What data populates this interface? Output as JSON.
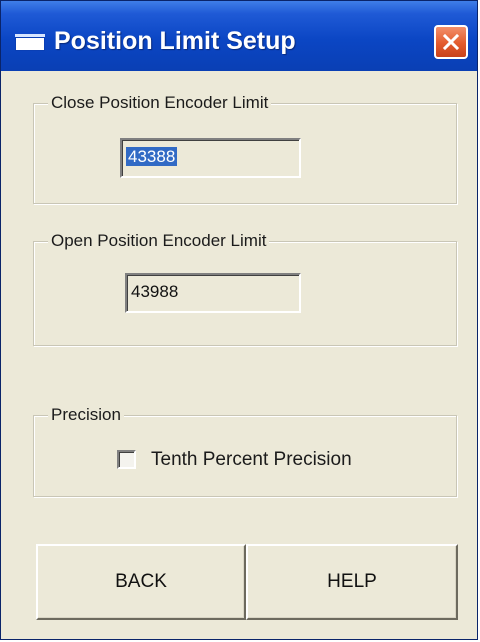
{
  "window": {
    "title": "Position Limit Setup",
    "title_icon": "window-icon",
    "close_icon": "close-icon"
  },
  "close_group": {
    "legend": "Close Position Encoder Limit",
    "value": "43388"
  },
  "open_group": {
    "legend": "Open Position Encoder Limit",
    "value": "43988"
  },
  "precision_group": {
    "legend": "Precision",
    "checkbox_label": "Tenth Percent Precision",
    "checked": false
  },
  "buttons": {
    "back_label": "BACK",
    "help_label": "HELP"
  },
  "colors": {
    "titlebar": "#0a46c4",
    "dialog_bg": "#ece9d8",
    "close_button": "#e35b2d",
    "selection": "#316ac5"
  }
}
